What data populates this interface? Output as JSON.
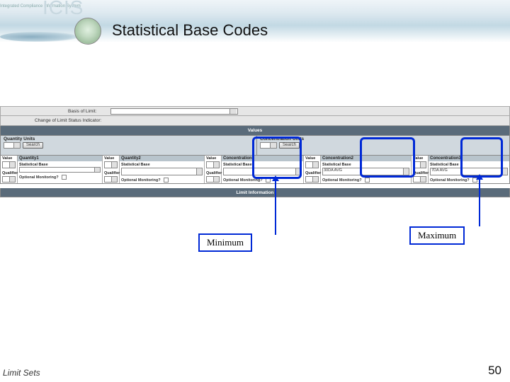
{
  "header": {
    "watermark": "ICIS",
    "tagline": "Integrated Compliance Information System",
    "title": "Statistical Base Codes"
  },
  "form": {
    "basis_label": "Basis of Limit:",
    "change_label": "Change of Limit Status Indicator:",
    "values_header": "Values",
    "quantity_units_label": "Quantity Units",
    "concentration_units_label": "Concentration Units",
    "search_label": "Search",
    "limit_info_header": "Limit Information",
    "tiny": {
      "value": "Value",
      "stat_base": "Statistical Base",
      "qualifier": "Qualifier",
      "optional_monitoring": "Optional Monitoring?"
    },
    "columns": [
      {
        "header": "Quantity1"
      },
      {
        "header": "Quantity2"
      },
      {
        "header": "Concentration1"
      },
      {
        "header": "Concentration2",
        "stat_base_value": "30DA AVG"
      },
      {
        "header": "Concentration3",
        "stat_base_value": "7DA AVG"
      }
    ]
  },
  "annotations": {
    "minimum": "Minimum",
    "maximum": "Maximum"
  },
  "footer": {
    "section": "Limit Sets",
    "page": "50"
  }
}
